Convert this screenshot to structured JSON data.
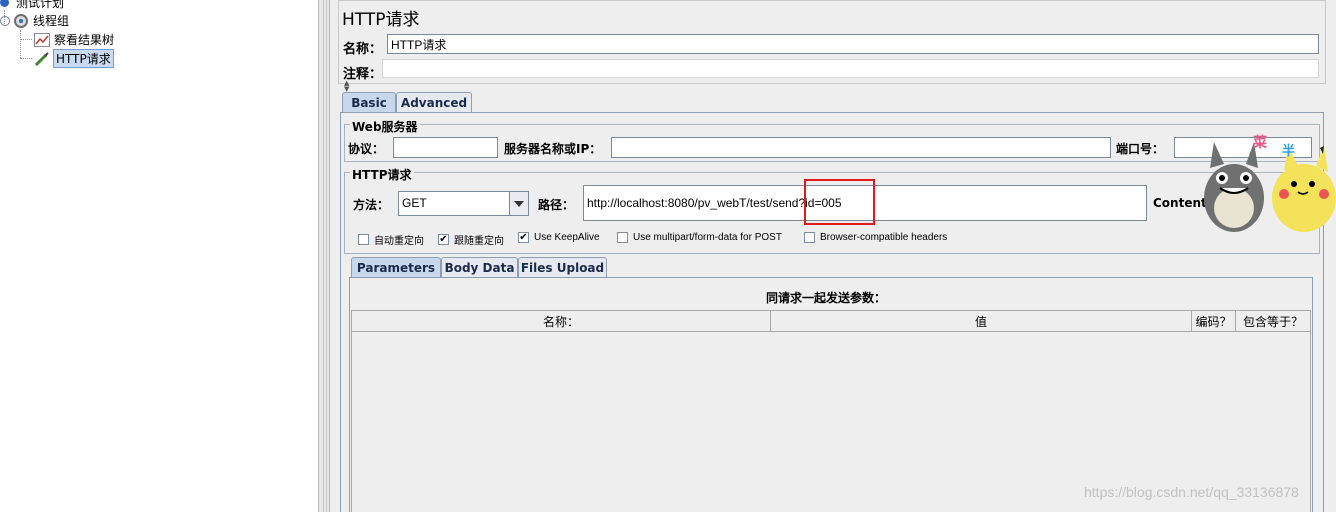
{
  "tree": {
    "root_label": "测试计划",
    "thread_group": "线程组",
    "listener": "察看结果树",
    "sampler": "HTTP请求"
  },
  "panel": {
    "title": "HTTP请求",
    "name_label": "名称：",
    "name_value": "HTTP请求",
    "comment_label": "注释："
  },
  "tabs": [
    "Basic",
    "Advanced"
  ],
  "web_server": {
    "title": "Web服务器",
    "protocol_label": "协议：",
    "server_label": "服务器名称或IP：",
    "port_label": "端口号："
  },
  "http_request": {
    "title": "HTTP请求",
    "method_label": "方法：",
    "method_value": "GET",
    "path_label": "路径：",
    "path_value": "http://localhost:8080/pv_webT/test/send?id=005",
    "content_encoding_label": "Content e"
  },
  "options": [
    {
      "label": "自动重定向",
      "checked": false
    },
    {
      "label": "跟随重定向",
      "checked": true
    },
    {
      "label": "Use KeepAlive",
      "checked": true
    },
    {
      "label": "Use multipart/form-data for POST",
      "checked": false
    },
    {
      "label": "Browser-compatible headers",
      "checked": false
    }
  ],
  "param_tabs": [
    "Parameters",
    "Body Data",
    "Files Upload"
  ],
  "params": {
    "caption": "同请求一起发送参数：",
    "columns": [
      "名称：",
      "值",
      "编码？",
      "包含等于？"
    ]
  },
  "sticker_text": [
    "菜",
    "半"
  ],
  "watermark": "https://blog.csdn.net/qq_33136878",
  "colors": {
    "highlight_box": "#e11b1b",
    "selected_tab": "#c8d8ec"
  }
}
